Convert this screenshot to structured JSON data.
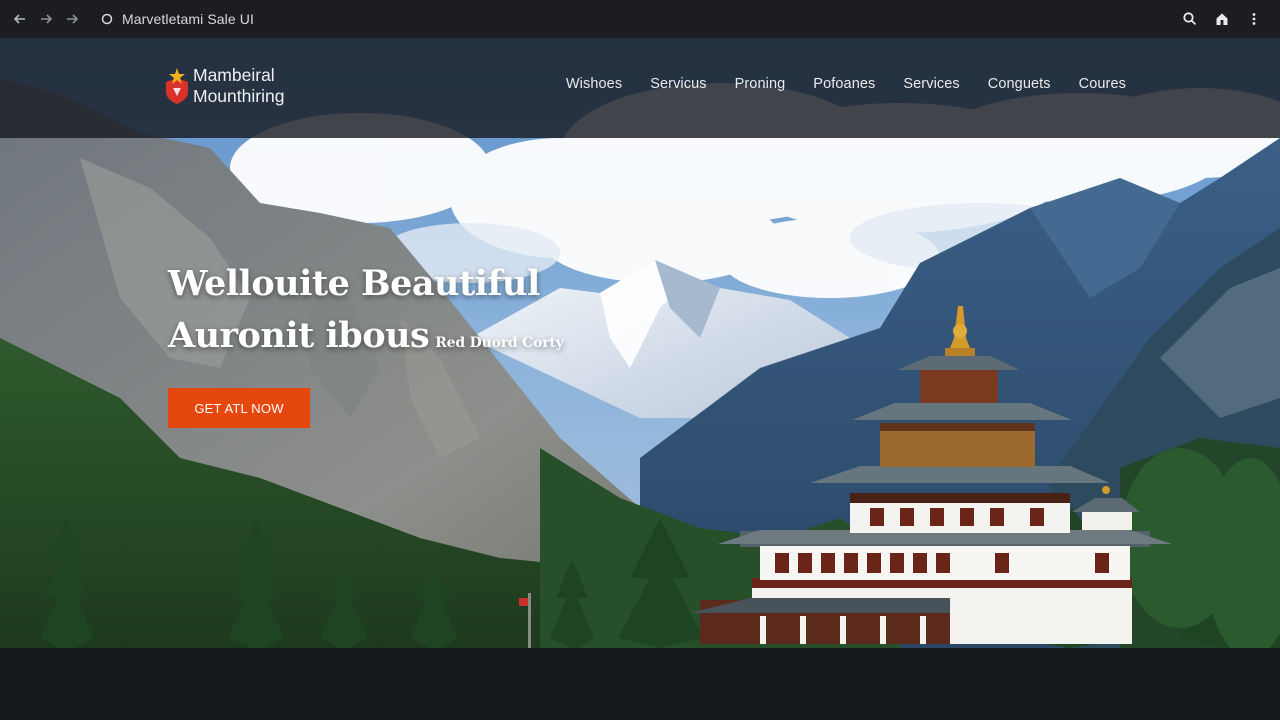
{
  "browser": {
    "tab_title": "Marvetletami Sale UI",
    "icons": [
      "back-arrow-icon",
      "forward-arrow-icon",
      "forward-arrow-icon",
      "site-info-icon",
      "search-icon",
      "home-icon",
      "more-menu-icon"
    ]
  },
  "header": {
    "brand_line1": "Mambeiral",
    "brand_line2": "Mounthiring",
    "nav": [
      "Wishoes",
      "Servicus",
      "Proning",
      "Pofoanes",
      "Services",
      "Conguets",
      "Coures"
    ]
  },
  "hero": {
    "title_line1": "Wellouite Beautiful",
    "title_line2": "Auronit ibous",
    "title_sub": "Red Duord Corty",
    "cta_label": "GET ATL NOW"
  },
  "colors": {
    "cta": "#e5470c",
    "chrome_bg": "#1b1d21",
    "header_overlay": "#181c22",
    "page_bg": "#15181d"
  }
}
